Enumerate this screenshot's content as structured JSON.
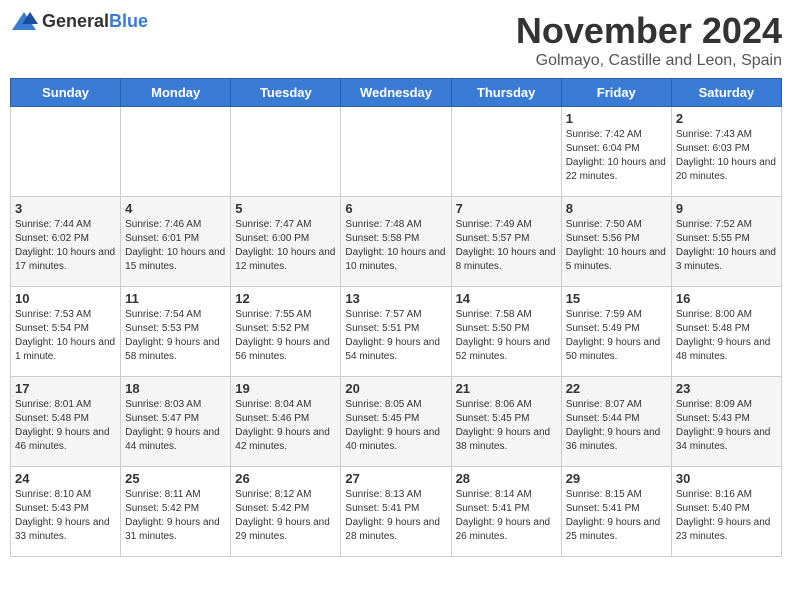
{
  "header": {
    "logo_general": "General",
    "logo_blue": "Blue",
    "month_title": "November 2024",
    "location": "Golmayo, Castille and Leon, Spain"
  },
  "weekdays": [
    "Sunday",
    "Monday",
    "Tuesday",
    "Wednesday",
    "Thursday",
    "Friday",
    "Saturday"
  ],
  "weeks": [
    [
      {
        "day": "",
        "info": ""
      },
      {
        "day": "",
        "info": ""
      },
      {
        "day": "",
        "info": ""
      },
      {
        "day": "",
        "info": ""
      },
      {
        "day": "",
        "info": ""
      },
      {
        "day": "1",
        "info": "Sunrise: 7:42 AM\nSunset: 6:04 PM\nDaylight: 10 hours and 22 minutes."
      },
      {
        "day": "2",
        "info": "Sunrise: 7:43 AM\nSunset: 6:03 PM\nDaylight: 10 hours and 20 minutes."
      }
    ],
    [
      {
        "day": "3",
        "info": "Sunrise: 7:44 AM\nSunset: 6:02 PM\nDaylight: 10 hours and 17 minutes."
      },
      {
        "day": "4",
        "info": "Sunrise: 7:46 AM\nSunset: 6:01 PM\nDaylight: 10 hours and 15 minutes."
      },
      {
        "day": "5",
        "info": "Sunrise: 7:47 AM\nSunset: 6:00 PM\nDaylight: 10 hours and 12 minutes."
      },
      {
        "day": "6",
        "info": "Sunrise: 7:48 AM\nSunset: 5:58 PM\nDaylight: 10 hours and 10 minutes."
      },
      {
        "day": "7",
        "info": "Sunrise: 7:49 AM\nSunset: 5:57 PM\nDaylight: 10 hours and 8 minutes."
      },
      {
        "day": "8",
        "info": "Sunrise: 7:50 AM\nSunset: 5:56 PM\nDaylight: 10 hours and 5 minutes."
      },
      {
        "day": "9",
        "info": "Sunrise: 7:52 AM\nSunset: 5:55 PM\nDaylight: 10 hours and 3 minutes."
      }
    ],
    [
      {
        "day": "10",
        "info": "Sunrise: 7:53 AM\nSunset: 5:54 PM\nDaylight: 10 hours and 1 minute."
      },
      {
        "day": "11",
        "info": "Sunrise: 7:54 AM\nSunset: 5:53 PM\nDaylight: 9 hours and 58 minutes."
      },
      {
        "day": "12",
        "info": "Sunrise: 7:55 AM\nSunset: 5:52 PM\nDaylight: 9 hours and 56 minutes."
      },
      {
        "day": "13",
        "info": "Sunrise: 7:57 AM\nSunset: 5:51 PM\nDaylight: 9 hours and 54 minutes."
      },
      {
        "day": "14",
        "info": "Sunrise: 7:58 AM\nSunset: 5:50 PM\nDaylight: 9 hours and 52 minutes."
      },
      {
        "day": "15",
        "info": "Sunrise: 7:59 AM\nSunset: 5:49 PM\nDaylight: 9 hours and 50 minutes."
      },
      {
        "day": "16",
        "info": "Sunrise: 8:00 AM\nSunset: 5:48 PM\nDaylight: 9 hours and 48 minutes."
      }
    ],
    [
      {
        "day": "17",
        "info": "Sunrise: 8:01 AM\nSunset: 5:48 PM\nDaylight: 9 hours and 46 minutes."
      },
      {
        "day": "18",
        "info": "Sunrise: 8:03 AM\nSunset: 5:47 PM\nDaylight: 9 hours and 44 minutes."
      },
      {
        "day": "19",
        "info": "Sunrise: 8:04 AM\nSunset: 5:46 PM\nDaylight: 9 hours and 42 minutes."
      },
      {
        "day": "20",
        "info": "Sunrise: 8:05 AM\nSunset: 5:45 PM\nDaylight: 9 hours and 40 minutes."
      },
      {
        "day": "21",
        "info": "Sunrise: 8:06 AM\nSunset: 5:45 PM\nDaylight: 9 hours and 38 minutes."
      },
      {
        "day": "22",
        "info": "Sunrise: 8:07 AM\nSunset: 5:44 PM\nDaylight: 9 hours and 36 minutes."
      },
      {
        "day": "23",
        "info": "Sunrise: 8:09 AM\nSunset: 5:43 PM\nDaylight: 9 hours and 34 minutes."
      }
    ],
    [
      {
        "day": "24",
        "info": "Sunrise: 8:10 AM\nSunset: 5:43 PM\nDaylight: 9 hours and 33 minutes."
      },
      {
        "day": "25",
        "info": "Sunrise: 8:11 AM\nSunset: 5:42 PM\nDaylight: 9 hours and 31 minutes."
      },
      {
        "day": "26",
        "info": "Sunrise: 8:12 AM\nSunset: 5:42 PM\nDaylight: 9 hours and 29 minutes."
      },
      {
        "day": "27",
        "info": "Sunrise: 8:13 AM\nSunset: 5:41 PM\nDaylight: 9 hours and 28 minutes."
      },
      {
        "day": "28",
        "info": "Sunrise: 8:14 AM\nSunset: 5:41 PM\nDaylight: 9 hours and 26 minutes."
      },
      {
        "day": "29",
        "info": "Sunrise: 8:15 AM\nSunset: 5:41 PM\nDaylight: 9 hours and 25 minutes."
      },
      {
        "day": "30",
        "info": "Sunrise: 8:16 AM\nSunset: 5:40 PM\nDaylight: 9 hours and 23 minutes."
      }
    ]
  ]
}
